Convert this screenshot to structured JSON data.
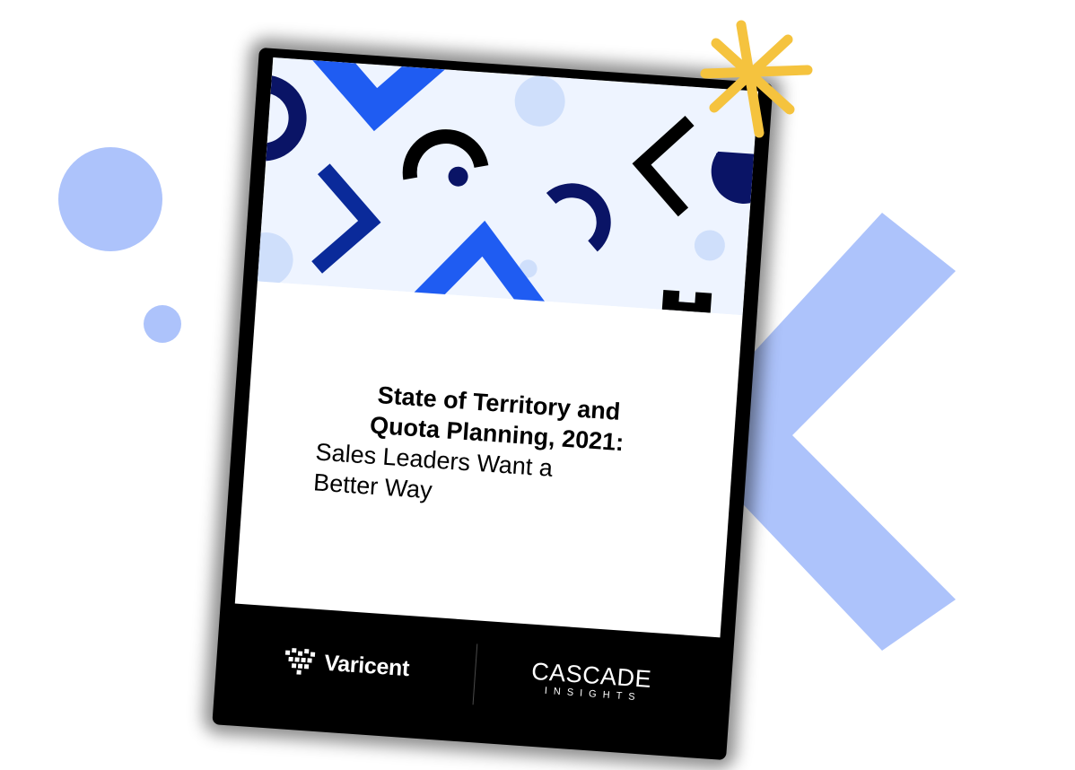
{
  "report": {
    "title_bold_lines": [
      "State of Territory and",
      "Quota Planning, 2021:"
    ],
    "subtitle_lines": [
      "Sales Leaders Want a",
      "Better Way"
    ]
  },
  "footer": {
    "left_logo": {
      "text": "Varicent",
      "icon": "varicent-pixel-heart-icon"
    },
    "right_logo": {
      "name": "CASCADE",
      "tagline": "INSIGHTS",
      "icon": "cascade-triangle-icon"
    }
  },
  "colors": {
    "periwinkle": "#adc3fb",
    "royal_blue": "#1f5cf2",
    "navy": "#0a1466",
    "pale_blue": "#cfdffb",
    "pattern_bg": "#eef4ff",
    "star_yellow": "#f5c33e",
    "black": "#000000",
    "white": "#ffffff"
  },
  "decorations": {
    "large_circle_icon": "circle-icon",
    "small_circle_icon": "circle-icon",
    "chevron_icon": "chevron-left-icon",
    "star_icon": "asterisk-star-icon"
  }
}
